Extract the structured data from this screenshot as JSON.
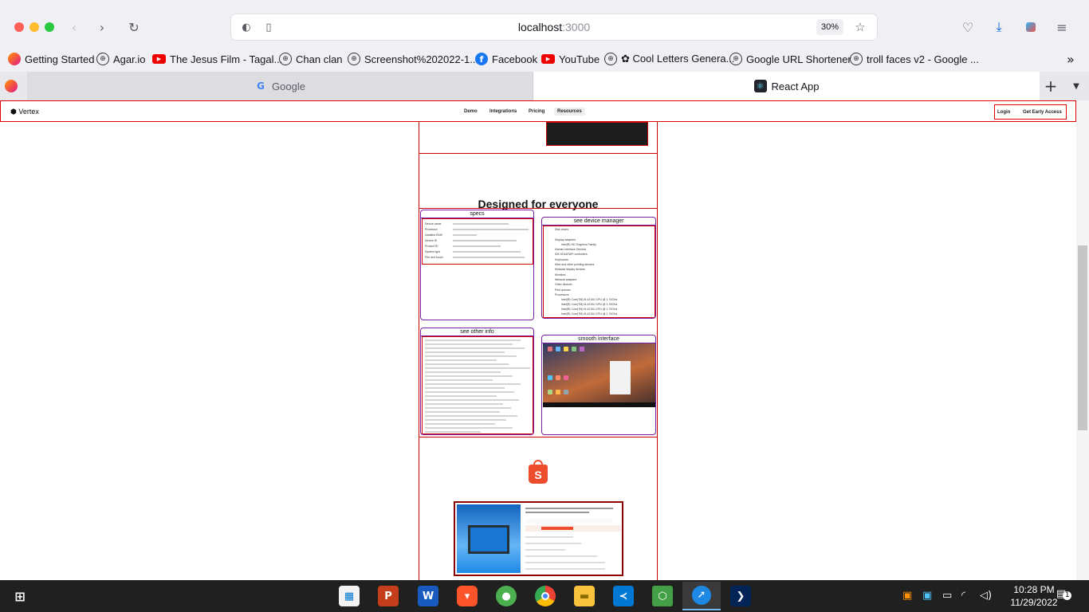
{
  "browser": {
    "url_host": "localhost",
    "url_port": ":3000",
    "zoom": "30%"
  },
  "bookmarks": [
    {
      "label": "Getting Started",
      "icon": "firefox-icon"
    },
    {
      "label": "Agar.io",
      "icon": "globe-icon"
    },
    {
      "label": "The Jesus Film - Tagal...",
      "icon": "youtube-icon"
    },
    {
      "label": "Chan clan",
      "icon": "globe-icon"
    },
    {
      "label": "Screenshot%202022-1...",
      "icon": "globe-icon"
    },
    {
      "label": "Facebook",
      "icon": "facebook-icon"
    },
    {
      "label": "YouTube",
      "icon": "youtube-icon"
    },
    {
      "label": "✿ Cool Letters Genera...",
      "icon": "globe-icon"
    },
    {
      "label": "Google URL Shortener",
      "icon": "globe-icon"
    },
    {
      "label": "troll faces v2 - Google ...",
      "icon": "globe-icon"
    }
  ],
  "tabs": [
    {
      "label": "Google"
    },
    {
      "label": "React App"
    }
  ],
  "site": {
    "brand": "Vertex",
    "nav": [
      "Demo",
      "Integrations",
      "Pricing",
      "Resources"
    ],
    "login": "Login",
    "cta": "Get Early Access",
    "section_title": "Designed for everyone",
    "cards": {
      "specs": "specs",
      "device_manager": "see device manager",
      "other_info": "see other info",
      "smooth": "smooth interface"
    },
    "spec_rows": [
      "Device name",
      "Processor",
      "Installed RAM",
      "Device ID",
      "Product ID",
      "System type",
      "Pen and touch"
    ],
    "device_rows": [
      "Disk drives",
      "Display adapters",
      "Intel(R) HD Graphics Family",
      "Human Interface Devices",
      "IDE ATA/ATAPI controllers",
      "Keyboards",
      "Mice and other pointing devices",
      "Miracast display devices",
      "Monitors",
      "Network adapters",
      "Other devices",
      "Print queues",
      "Processors",
      "Intel(R) Core(TM) i5-4210U CPU @ 1.70GHz"
    ]
  },
  "taskbar": {
    "time": "10:28 PM",
    "date": "11/29/2022",
    "notification_count": "1"
  }
}
